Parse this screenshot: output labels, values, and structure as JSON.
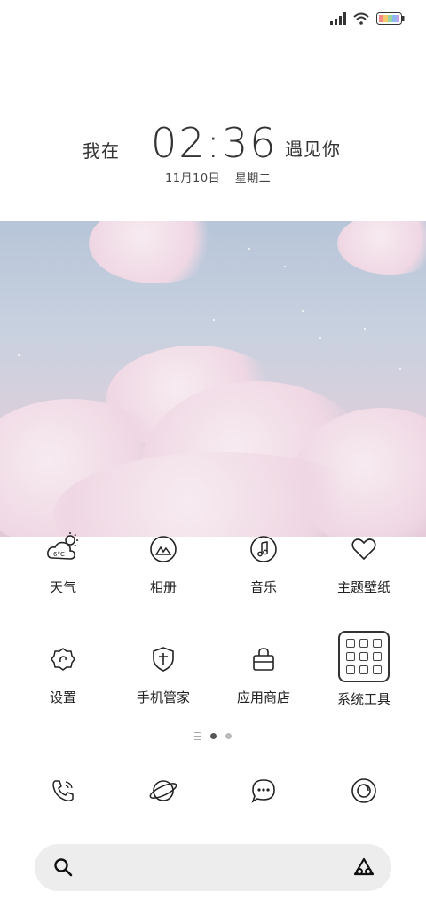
{
  "clock": {
    "prefix": "我在",
    "time": "02:36",
    "suffix": "遇见你",
    "date": "11月10日",
    "weekday": "星期二"
  },
  "weather_temp": "6°C",
  "apps": [
    {
      "label": "天气",
      "icon": "weather-icon"
    },
    {
      "label": "相册",
      "icon": "gallery-icon"
    },
    {
      "label": "音乐",
      "icon": "music-icon"
    },
    {
      "label": "主题壁纸",
      "icon": "theme-icon"
    },
    {
      "label": "设置",
      "icon": "settings-icon"
    },
    {
      "label": "手机管家",
      "icon": "security-icon"
    },
    {
      "label": "应用商店",
      "icon": "app-store-icon"
    },
    {
      "label": "系统工具",
      "icon": "tools-folder-icon"
    }
  ],
  "dock": [
    "phone-icon",
    "browser-icon",
    "messages-icon",
    "camera-icon"
  ],
  "page_indicator": {
    "pages": 2,
    "active": 0
  },
  "colors": {
    "search_bg": "#ededed",
    "text": "#222222",
    "wallpaper_top": "#b7c5d9",
    "wallpaper_bottom": "#e3c8d7"
  }
}
